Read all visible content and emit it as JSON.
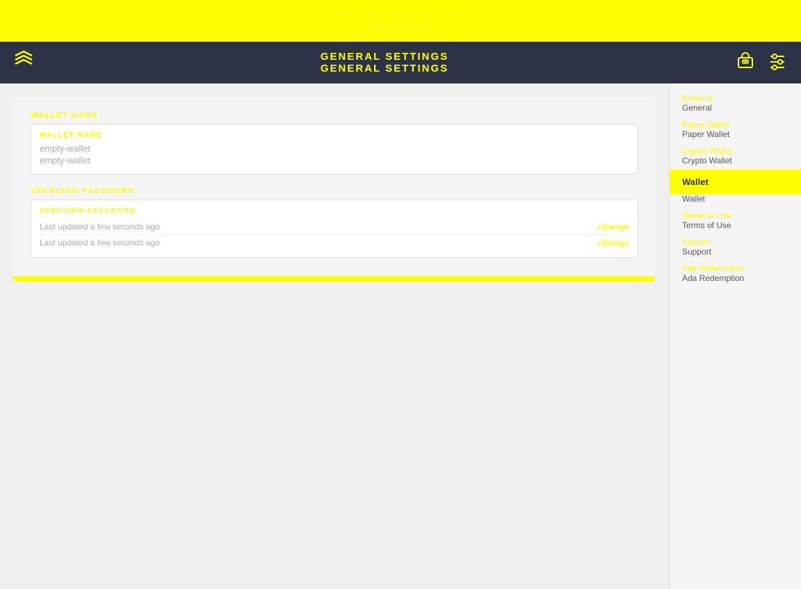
{
  "top_banner": {
    "line1": "· · · · · · · · · · · · · · · · · · · · · · · ·",
    "line2": "· · · · · · · ·"
  },
  "header": {
    "title_line1": "GENERAL SETTINGS",
    "title_line2": "GENERAL SETTINGS",
    "logo_icon": "❖",
    "icon_bag": "🛍",
    "icon_sliders": "🎛"
  },
  "wallet_name_section": {
    "outer_label": "WALLET NAME",
    "inner_label": "WALLET NAME",
    "value1": "empty-wallet",
    "value2": "empty-wallet"
  },
  "spending_password_section": {
    "outer_label": "SPENDING PASSWORD",
    "inner_label": "SPENDING PASSWORD",
    "row1_text": "Last updated a few seconds ago",
    "row1_btn": "change",
    "row2_text": "Last updated a few seconds ago",
    "row2_btn": "change"
  },
  "sidebar": {
    "items": [
      {
        "id": "general1",
        "label_yellow": "General",
        "label_dark": "General",
        "active": false
      },
      {
        "id": "paper-wallet",
        "label_yellow": "Paper Wallet",
        "label_dark": "Paper Wallet",
        "active": false
      },
      {
        "id": "crypto-wallet",
        "label_yellow": "Crypto Wallet",
        "label_dark": "Crypto Wallet",
        "active": false
      },
      {
        "id": "wallet",
        "label_yellow": "Wallet",
        "label_dark": "Wallet",
        "active": true
      },
      {
        "id": "terms",
        "label_yellow": "Terms of Use",
        "label_dark": "Terms of Use",
        "active": false
      },
      {
        "id": "support",
        "label_yellow": "Support",
        "label_dark": "Support",
        "active": false
      },
      {
        "id": "ada-redemption",
        "label_yellow": "Ada Redemption",
        "label_dark": "Ada Redemption",
        "active": false
      }
    ]
  },
  "bottom_bar_visible": true
}
